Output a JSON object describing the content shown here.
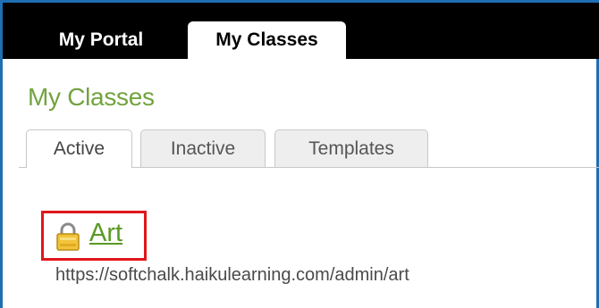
{
  "top_nav": {
    "tabs": [
      {
        "label": "My Portal",
        "active": false
      },
      {
        "label": "My Classes",
        "active": true
      }
    ]
  },
  "page": {
    "title": "My Classes"
  },
  "sub_tabs": [
    {
      "label": "Active",
      "active": true
    },
    {
      "label": "Inactive",
      "active": false
    },
    {
      "label": "Templates",
      "active": false
    }
  ],
  "classes": [
    {
      "name": "Art",
      "url": "https://softchalk.haikulearning.com/admin/art",
      "icon": "lock-icon"
    }
  ],
  "colors": {
    "frame": "#1f6fb4",
    "topbar": "#000000",
    "title_green": "#72a33f",
    "link_green": "#5a9a23",
    "highlight_red": "#e0161b"
  }
}
